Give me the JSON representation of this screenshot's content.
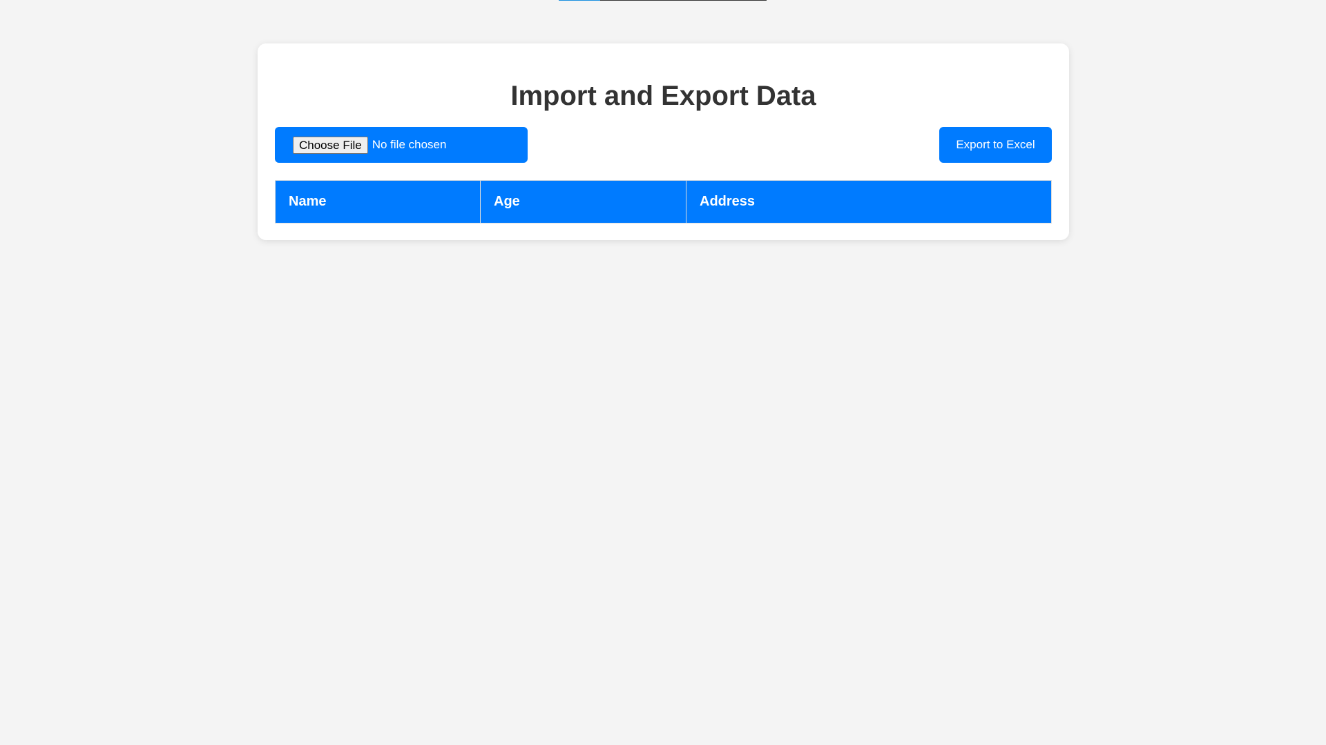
{
  "page": {
    "title": "Import and Export Data"
  },
  "top_progress": {
    "fraction": 0.2
  },
  "import": {
    "choose_label": "Choose File",
    "status": "No file chosen"
  },
  "export": {
    "label": "Export to Excel"
  },
  "table": {
    "headers": [
      "Name",
      "Age",
      "Address"
    ]
  },
  "colors": {
    "accent": "#007bff",
    "background": "#f4f4f4",
    "title": "#333333"
  }
}
